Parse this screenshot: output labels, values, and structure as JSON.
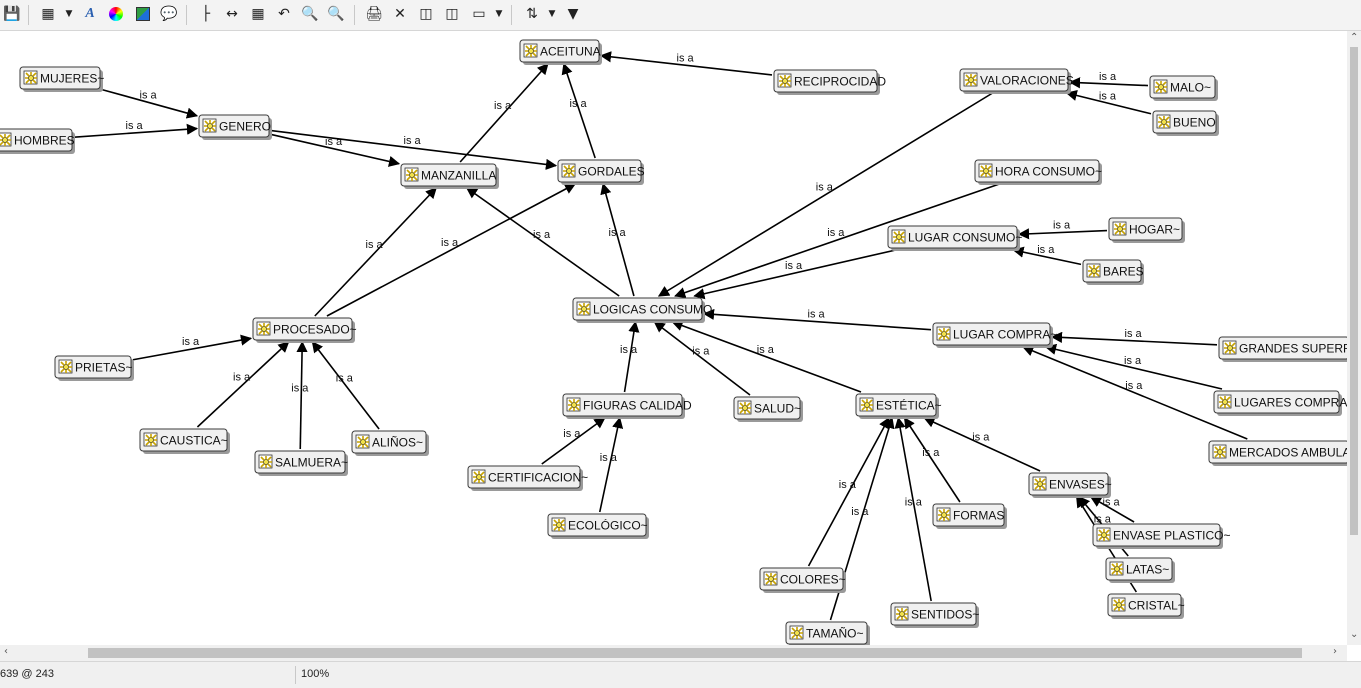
{
  "toolbar": {
    "icons": [
      "save-icon",
      "add-concept-icon",
      "dropdown-arrow",
      "font-icon",
      "color-wheel-icon",
      "image-icon",
      "speech-bubble-icon",
      "tree-layout-icon",
      "expand-width-icon",
      "grid-icon",
      "undo-icon",
      "zoom-out-icon",
      "zoom-in-icon",
      "print-icon",
      "delete-icon",
      "link-nodes-icon",
      "unlink-nodes-icon",
      "shape-icon",
      "dropdown-arrow",
      "sort-icon",
      "dropdown-arrow",
      "filter-icon"
    ]
  },
  "status": {
    "coords": "639 @ 243",
    "zoom": "100%"
  },
  "link_label": "is a",
  "nodes": [
    {
      "id": "aceituna",
      "label": "ACEITUNA"
    },
    {
      "id": "reciprocidad",
      "label": "RECIPROCIDAD"
    },
    {
      "id": "mujeres",
      "label": "MUJERES~"
    },
    {
      "id": "hombres",
      "label": "HOMBRES"
    },
    {
      "id": "genero",
      "label": "GENERO"
    },
    {
      "id": "manzanilla",
      "label": "MANZANILLA"
    },
    {
      "id": "gordales",
      "label": "GORDALES"
    },
    {
      "id": "valoraciones",
      "label": "VALORACIONES"
    },
    {
      "id": "malo",
      "label": "MALO~"
    },
    {
      "id": "bueno",
      "label": "BUENO"
    },
    {
      "id": "hora_consumo",
      "label": "HORA CONSUMO~"
    },
    {
      "id": "lugar_consumo",
      "label": "LUGAR CONSUMO~"
    },
    {
      "id": "hogar",
      "label": "HOGAR~"
    },
    {
      "id": "bares",
      "label": "BARES"
    },
    {
      "id": "logicas_consumo",
      "label": "LOGICAS CONSUMO"
    },
    {
      "id": "procesado",
      "label": "PROCESADO~"
    },
    {
      "id": "prietas",
      "label": "PRIETAS~"
    },
    {
      "id": "caustica",
      "label": "CAUSTICA~"
    },
    {
      "id": "salmuera",
      "label": "SALMUERA~"
    },
    {
      "id": "alinos",
      "label": "ALIÑOS~"
    },
    {
      "id": "lugar_compra",
      "label": "LUGAR COMPRA~"
    },
    {
      "id": "grandes_superficies",
      "label": "GRANDES SUPERFICI"
    },
    {
      "id": "lugares_compra",
      "label": "LUGARES COMPRA"
    },
    {
      "id": "mercados_ambulantes",
      "label": "MERCADOS AMBULANT"
    },
    {
      "id": "figuras_calidad",
      "label": "FIGURAS CALIDAD"
    },
    {
      "id": "certificacion",
      "label": "CERTIFICACION~"
    },
    {
      "id": "ecologico",
      "label": "ECOLÓGICO~"
    },
    {
      "id": "salud",
      "label": "SALUD~"
    },
    {
      "id": "estetica",
      "label": "ESTÉTICA~"
    },
    {
      "id": "envases",
      "label": "ENVASES~"
    },
    {
      "id": "envase_plastico",
      "label": "ENVASE PLASTICO~"
    },
    {
      "id": "latas",
      "label": "LATAS~"
    },
    {
      "id": "cristal",
      "label": "CRISTAL~"
    },
    {
      "id": "formas",
      "label": "FORMAS"
    },
    {
      "id": "colores",
      "label": "COLORES~"
    },
    {
      "id": "sentidos",
      "label": "SENTIDOS~"
    },
    {
      "id": "tamano",
      "label": "TAMAÑO~"
    }
  ],
  "links": [
    {
      "from": "reciprocidad",
      "to": "aceituna",
      "label": "is a"
    },
    {
      "from": "manzanilla",
      "to": "aceituna",
      "label": "is a"
    },
    {
      "from": "gordales",
      "to": "aceituna",
      "label": "is a"
    },
    {
      "from": "mujeres",
      "to": "genero",
      "label": "is a"
    },
    {
      "from": "hombres",
      "to": "genero",
      "label": "is a"
    },
    {
      "from": "genero",
      "to": "manzanilla",
      "label": "is a"
    },
    {
      "from": "genero",
      "to": "gordales",
      "label": "is a"
    },
    {
      "from": "malo",
      "to": "valoraciones",
      "label": "is a"
    },
    {
      "from": "bueno",
      "to": "valoraciones",
      "label": "is a"
    },
    {
      "from": "valoraciones",
      "to": "logicas_consumo",
      "label": "is a"
    },
    {
      "from": "hora_consumo",
      "to": "logicas_consumo",
      "label": "is a"
    },
    {
      "from": "lugar_consumo",
      "to": "logicas_consumo",
      "label": "is a"
    },
    {
      "from": "hogar",
      "to": "lugar_consumo",
      "label": "is a"
    },
    {
      "from": "bares",
      "to": "lugar_consumo",
      "label": "is a"
    },
    {
      "from": "logicas_consumo",
      "to": "manzanilla",
      "label": "is a"
    },
    {
      "from": "logicas_consumo",
      "to": "gordales",
      "label": "is a"
    },
    {
      "from": "procesado",
      "to": "manzanilla",
      "label": "is a"
    },
    {
      "from": "procesado",
      "to": "gordales",
      "label": "is a"
    },
    {
      "from": "prietas",
      "to": "procesado",
      "label": "is a"
    },
    {
      "from": "caustica",
      "to": "procesado",
      "label": "is a"
    },
    {
      "from": "salmuera",
      "to": "procesado",
      "label": "is a"
    },
    {
      "from": "alinos",
      "to": "procesado",
      "label": "is a"
    },
    {
      "from": "lugar_compra",
      "to": "logicas_consumo",
      "label": "is a"
    },
    {
      "from": "grandes_superficies",
      "to": "lugar_compra",
      "label": "is a"
    },
    {
      "from": "lugares_compra",
      "to": "lugar_compra",
      "label": "is a"
    },
    {
      "from": "mercados_ambulantes",
      "to": "lugar_compra",
      "label": "is a"
    },
    {
      "from": "figuras_calidad",
      "to": "logicas_consumo",
      "label": "is a"
    },
    {
      "from": "certificacion",
      "to": "figuras_calidad",
      "label": "is a"
    },
    {
      "from": "ecologico",
      "to": "figuras_calidad",
      "label": "is a"
    },
    {
      "from": "salud",
      "to": "logicas_consumo",
      "label": "is a"
    },
    {
      "from": "estetica",
      "to": "logicas_consumo",
      "label": "is a"
    },
    {
      "from": "envases",
      "to": "estetica",
      "label": "is a"
    },
    {
      "from": "envase_plastico",
      "to": "envases",
      "label": "is a"
    },
    {
      "from": "latas",
      "to": "envases",
      "label": "is a"
    },
    {
      "from": "cristal",
      "to": "envases",
      "label": "is a"
    },
    {
      "from": "formas",
      "to": "estetica",
      "label": "is a"
    },
    {
      "from": "colores",
      "to": "estetica",
      "label": "is a"
    },
    {
      "from": "sentidos",
      "to": "estetica",
      "label": "is a"
    },
    {
      "from": "tamano",
      "to": "estetica",
      "label": "is a"
    }
  ]
}
